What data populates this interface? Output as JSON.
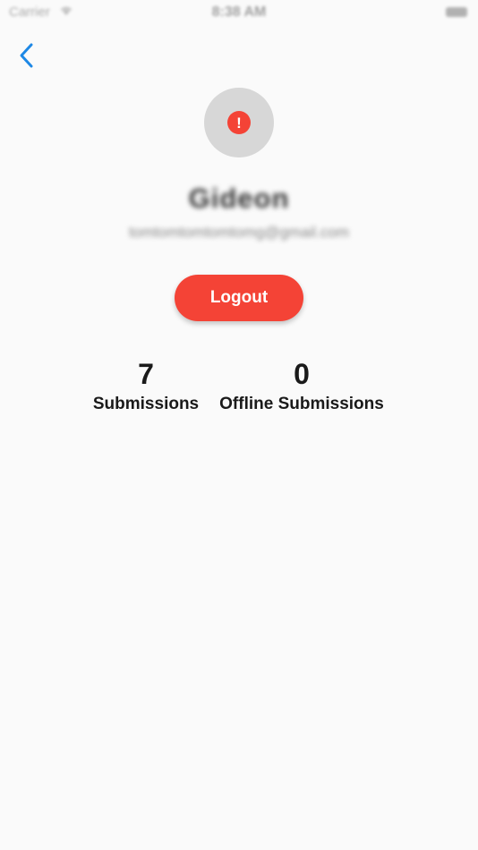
{
  "status_bar": {
    "carrier": "Carrier",
    "time": "8:38 AM"
  },
  "nav": {
    "back_icon": "chevron-left-icon",
    "accent_color": "#1e88e5"
  },
  "profile": {
    "avatar_icon": "alert-icon",
    "alert_symbol": "!",
    "name": "Gideon",
    "email": "tomtomtomtomtomg@gmail.com"
  },
  "actions": {
    "logout_label": "Logout",
    "logout_color": "#f44336"
  },
  "stats": {
    "submissions_value": "7",
    "submissions_label": "Submissions",
    "offline_value": "0",
    "offline_label": "Offline Submissions"
  }
}
